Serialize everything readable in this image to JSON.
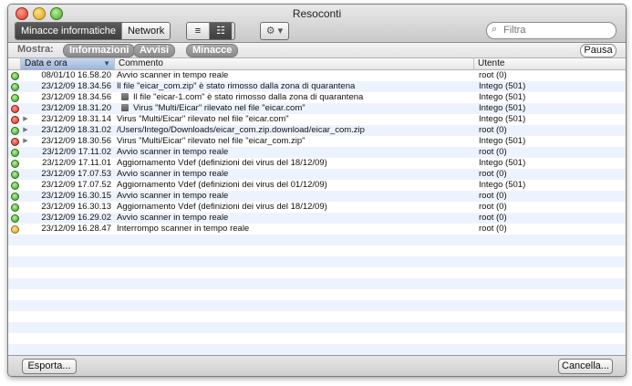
{
  "window": {
    "title": "Resoconti"
  },
  "toolbar": {
    "segments": [
      "Minacce informatiche",
      "Network"
    ],
    "view_icons": [
      "list-compact-icon",
      "list-detail-icon"
    ],
    "gear_icon": "gear-icon",
    "search_placeholder": "Filtra"
  },
  "filter": {
    "label": "Mostra:",
    "pills": [
      "Informazioni",
      "Avvisi",
      "Minacce"
    ],
    "pause_label": "Pausa"
  },
  "table": {
    "columns": [
      "Data e ora",
      "Commento",
      "Utente"
    ],
    "rows": [
      {
        "status": "green",
        "expand": false,
        "sub": false,
        "date": "08/01/10 16.58.20",
        "comment": "Avvio scanner in tempo reale",
        "user": "root (0)"
      },
      {
        "status": "green",
        "expand": false,
        "sub": false,
        "date": "23/12/09 18.34.56",
        "comment": "Il file \"eicar_com.zip\" è stato rimosso dalla zona di quarantena",
        "user": "Intego (501)"
      },
      {
        "status": "green",
        "expand": false,
        "sub": true,
        "date": "23/12/09 18.34.56",
        "comment": "Il file \"eicar-1.com\" è stato rimosso dalla zona di quarantena",
        "user": "Intego (501)"
      },
      {
        "status": "red",
        "expand": false,
        "sub": true,
        "date": "23/12/09 18.31.20",
        "comment": "Virus \"Multi/Eicar\" rilevato nel file \"eicar.com\"",
        "user": "Intego (501)"
      },
      {
        "status": "red",
        "expand": true,
        "sub": false,
        "date": "23/12/09 18.31.14",
        "comment": "Virus \"Multi/Eicar\" rilevato nel file \"eicar.com\"",
        "user": "Intego (501)"
      },
      {
        "status": "green",
        "expand": true,
        "sub": false,
        "date": "23/12/09 18.31.02",
        "comment": "/Users/Intego/Downloads/eicar_com.zip.download/eicar_com.zip",
        "user": "root (0)"
      },
      {
        "status": "red",
        "expand": true,
        "sub": false,
        "date": "23/12/09 18.30.56",
        "comment": "Virus \"Multi/Eicar\" rilevato nel file \"eicar_com.zip\"",
        "user": "Intego (501)"
      },
      {
        "status": "green",
        "expand": false,
        "sub": false,
        "date": "23/12/09 17.11.02",
        "comment": "Avvio scanner in tempo reale",
        "user": "root (0)"
      },
      {
        "status": "green",
        "expand": false,
        "sub": false,
        "date": "23/12/09 17.11.01",
        "comment": "Aggiornamento Vdef (definizioni dei virus del 18/12/09)",
        "user": "Intego (501)"
      },
      {
        "status": "green",
        "expand": false,
        "sub": false,
        "date": "23/12/09 17.07.53",
        "comment": "Avvio scanner in tempo reale",
        "user": "root (0)"
      },
      {
        "status": "green",
        "expand": false,
        "sub": false,
        "date": "23/12/09 17.07.52",
        "comment": "Aggiornamento Vdef (definizioni dei virus del 01/12/09)",
        "user": "Intego (501)"
      },
      {
        "status": "green",
        "expand": false,
        "sub": false,
        "date": "23/12/09 16.30.15",
        "comment": "Avvio scanner in tempo reale",
        "user": "root (0)"
      },
      {
        "status": "green",
        "expand": false,
        "sub": false,
        "date": "23/12/09 16.30.13",
        "comment": "Aggiornamento Vdef (definizioni dei virus del 18/12/09)",
        "user": "root (0)"
      },
      {
        "status": "green",
        "expand": false,
        "sub": false,
        "date": "23/12/09 16.29.02",
        "comment": "Avvio scanner in tempo reale",
        "user": "root (0)"
      },
      {
        "status": "yellow",
        "expand": false,
        "sub": false,
        "date": "23/12/09 16.28.47",
        "comment": "Interrompo scanner in tempo reale",
        "user": "root (0)"
      }
    ]
  },
  "bottom": {
    "export_label": "Esporta...",
    "clear_label": "Cancella..."
  }
}
